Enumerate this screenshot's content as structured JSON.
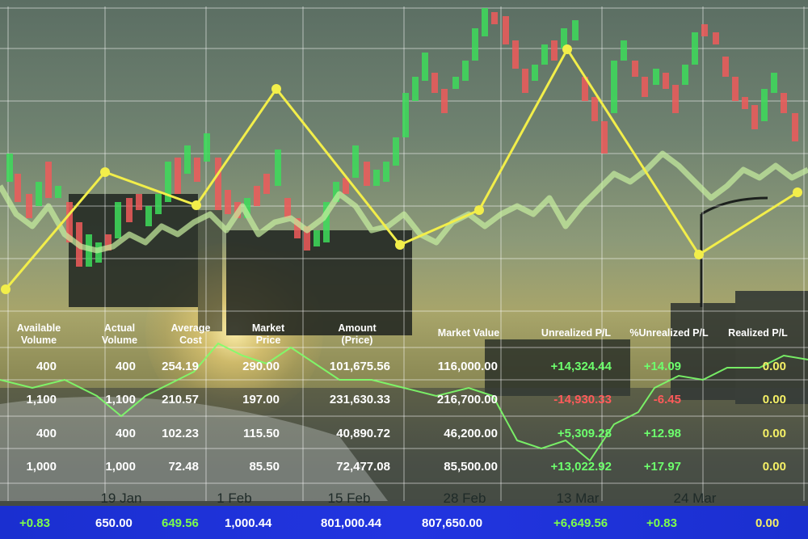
{
  "chart_data": {
    "type": "table",
    "x_axis_labels": [
      "19 Jan",
      "1 Feb",
      "15 Feb",
      "28 Feb",
      "13 Mar",
      "24 Mar"
    ],
    "columns": [
      "Available Volume",
      "Actual Volume",
      "Average Cost",
      "Market Price",
      "Amount (Price)",
      "Market Value",
      "Unrealized P/L",
      "%Unrealized P/L",
      "Realized P/L"
    ],
    "rows": [
      [
        "400",
        "400",
        "254.19",
        "290.00",
        "101,675.56",
        "116,000.00",
        "+14,324.44",
        "+14.09",
        "0.00"
      ],
      [
        "1,100",
        "1,100",
        "210.57",
        "197.00",
        "231,630.33",
        "216,700.00",
        "-14,930.33",
        "-6.45",
        "0.00"
      ],
      [
        "400",
        "400",
        "102.23",
        "115.50",
        "40,890.72",
        "46,200.00",
        "+5,309.28",
        "+12.98",
        "0.00"
      ],
      [
        "1,000",
        "1,000",
        "72.48",
        "85.50",
        "72,477.08",
        "85,500.00",
        "+13,022.92",
        "+17.97",
        "0.00"
      ]
    ],
    "totals": [
      "+0.83",
      "650.00",
      "649.56",
      "1,000.44",
      "801,000.44",
      "807,650.00",
      "+6,649.56",
      "+0.83",
      "0.00"
    ],
    "grid": true,
    "colors": {
      "positive": "#6dff6d",
      "negative": "#ff5a5a",
      "neutral": "#ffffff",
      "realized": "#f5f066",
      "yellow_line": "#f2ee4a",
      "green_line": "#c8f0a0",
      "candle_up": "#3ddc5a",
      "candle_down": "#ee5a5a",
      "footer_bg": "#2235e0"
    }
  }
}
